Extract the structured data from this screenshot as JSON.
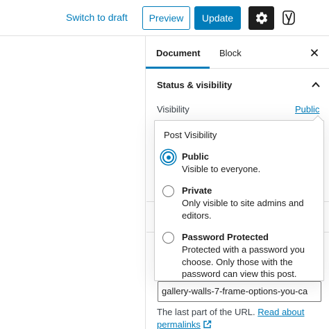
{
  "header": {
    "switch_to_draft": "Switch to draft",
    "preview": "Preview",
    "update": "Update"
  },
  "tabs": {
    "document": "Document",
    "block": "Block"
  },
  "status_panel": {
    "title": "Status & visibility",
    "visibility_label": "Visibility",
    "visibility_value": "Public"
  },
  "popover": {
    "title": "Post Visibility",
    "options": [
      {
        "label": "Public",
        "description": "Visible to everyone.",
        "checked": true
      },
      {
        "label": "Private",
        "description": "Only visible to site admins and editors.",
        "checked": false
      },
      {
        "label": "Password Protected",
        "description": "Protected with a password you choose. Only those with the password can view this post.",
        "checked": false
      }
    ]
  },
  "permalink": {
    "slug": "gallery-walls-7-frame-options-you-ca",
    "help_text": "The last part of the URL.",
    "help_link": "Read about permalinks"
  },
  "colors": {
    "accent": "#007cba",
    "dark": "#1e1e1e",
    "border": "#e0e0e0"
  }
}
